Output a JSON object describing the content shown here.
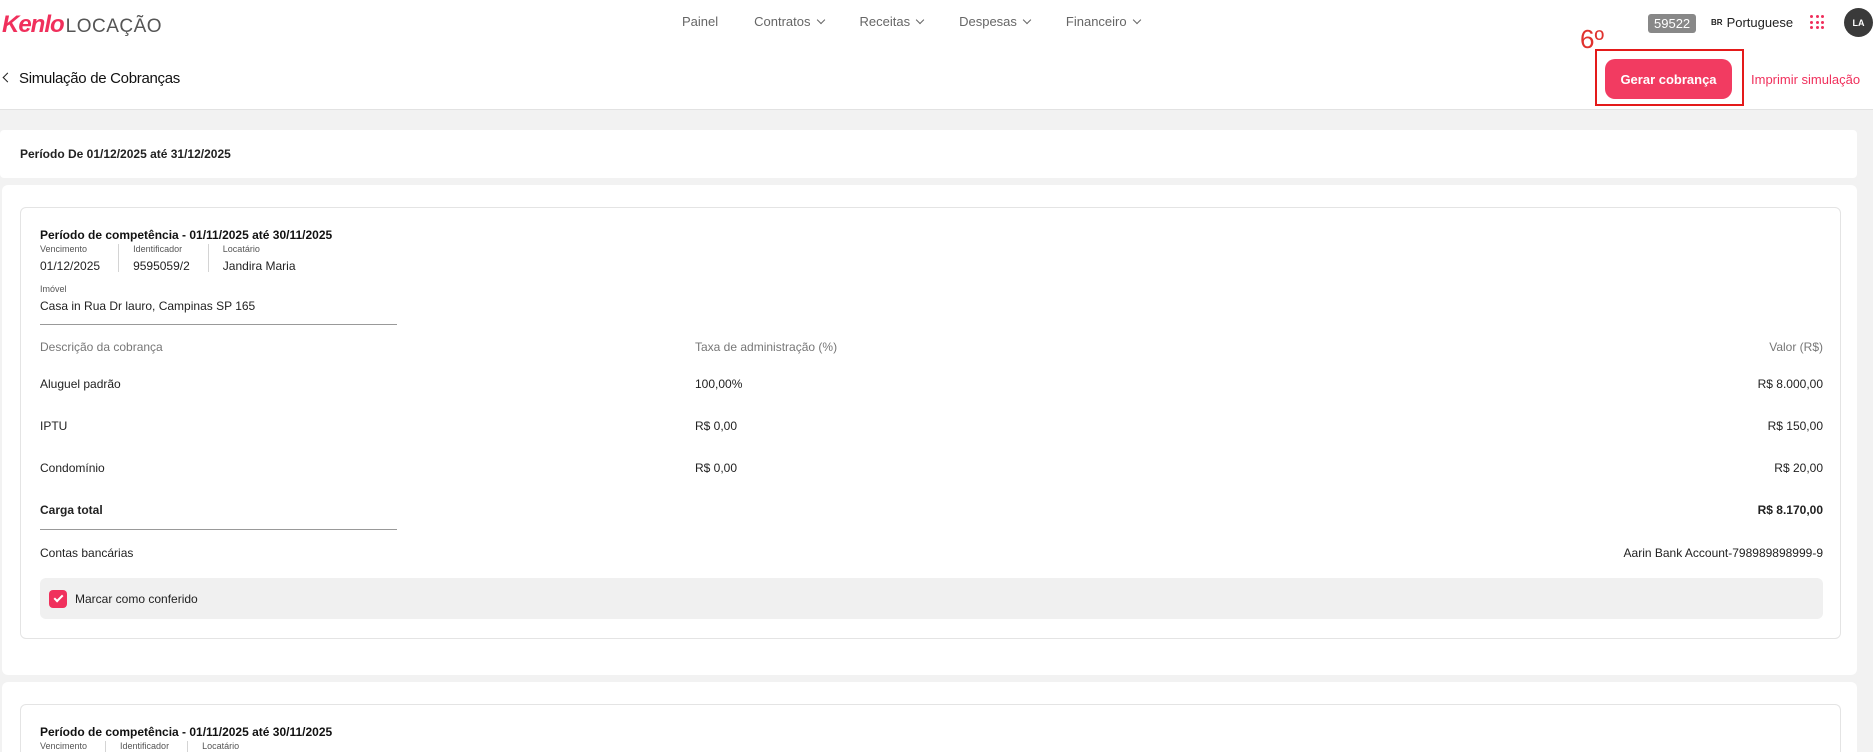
{
  "header": {
    "brand": "Kenlo",
    "product": "LOCAÇÃO",
    "nav": [
      {
        "label": "Painel",
        "dropdown": false
      },
      {
        "label": "Contratos",
        "dropdown": true
      },
      {
        "label": "Receitas",
        "dropdown": true
      },
      {
        "label": "Despesas",
        "dropdown": true
      },
      {
        "label": "Financeiro",
        "dropdown": true
      }
    ],
    "env_badge": "59522",
    "language_code": "BR",
    "language": "Portuguese",
    "avatar_initials": "LA"
  },
  "page": {
    "title": "Simulação de Cobranças",
    "step_annotation": "6º",
    "primary_button": "Gerar cobrança",
    "print_link": "Imprimir simulação",
    "period": "Período De 01/12/2025 até 31/12/2025"
  },
  "labels": {
    "vencimento": "Vencimento",
    "identificador": "Identificador",
    "locatario": "Locatário",
    "imovel": "Imóvel",
    "col_descricao": "Descrição da cobrança",
    "col_taxa": "Taxa de administração (%)",
    "col_valor": "Valor (R$)",
    "total": "Carga total",
    "contas": "Contas bancárias",
    "checkbox": "Marcar como conferido"
  },
  "charges": [
    {
      "competencia": "Período de competência - 01/11/2025 até 30/11/2025",
      "vencimento": "01/12/2025",
      "identificador": "9595059/2",
      "locatario": "Jandira Maria",
      "imovel": "Casa in Rua Dr lauro, Campinas SP 165",
      "items": [
        {
          "descricao": "Aluguel padrão",
          "taxa": "100,00%",
          "valor": "R$ 8.000,00"
        },
        {
          "descricao": "IPTU",
          "taxa": "R$ 0,00",
          "valor": "R$ 150,00"
        },
        {
          "descricao": "Condomínio",
          "taxa": "R$ 0,00",
          "valor": "R$ 20,00"
        }
      ],
      "total": "R$ 8.170,00",
      "conta": "Aarin Bank Account-798989898999-9",
      "conferido": true
    },
    {
      "competencia": "Período de competência - 01/11/2025 até 30/11/2025"
    }
  ],
  "colors": {
    "accent": "#f0305c",
    "annotation": "#e41a1a"
  }
}
